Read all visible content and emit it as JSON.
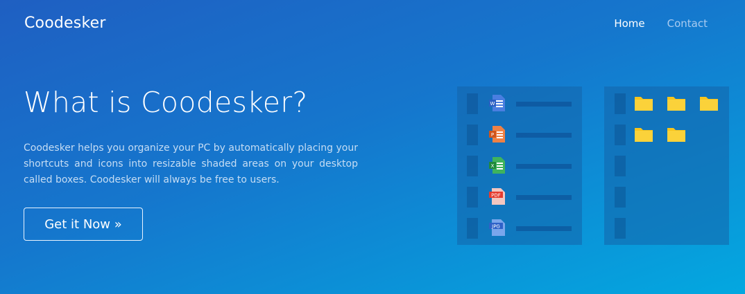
{
  "header": {
    "brand": "Coodesker"
  },
  "nav": {
    "items": [
      "Home",
      "Contact"
    ]
  },
  "hero": {
    "title": "What is Coodesker?",
    "description": "Coodesker helps you organize your PC by automatically placing your shortcuts and icons into resizable shaded areas on your desktop called boxes. Coodesker will always be free to users.",
    "cta_label": "Get it Now »"
  },
  "illustration": {
    "file_icons": [
      {
        "name": "word-doc-icon",
        "label": "W",
        "color": "#3a6fd8"
      },
      {
        "name": "powerpoint-doc-icon",
        "label": "P",
        "color": "#e46b2d"
      },
      {
        "name": "excel-doc-icon",
        "label": "X",
        "color": "#2e9a4a"
      },
      {
        "name": "pdf-doc-icon",
        "label": "PDF",
        "color": "#e53a2f"
      },
      {
        "name": "jpg-doc-icon",
        "label": "JPG",
        "color": "#3e78d8"
      }
    ],
    "folder_color": "#f8c51c"
  }
}
